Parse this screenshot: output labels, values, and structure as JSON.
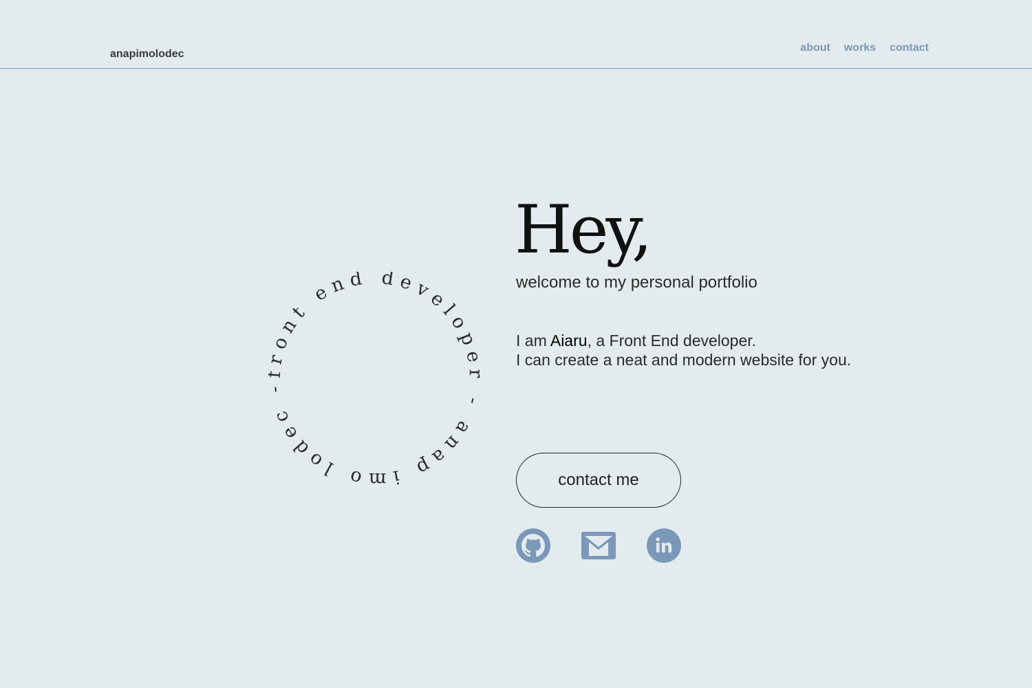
{
  "header": {
    "logo": "anapimolodec",
    "nav": [
      {
        "label": "about"
      },
      {
        "label": "works"
      },
      {
        "label": "contact"
      }
    ]
  },
  "badge": {
    "circular_text": "front end developer - anap imo lodec -"
  },
  "hero": {
    "heading": "Hey,",
    "subtitle": "welcome to my personal portfolio",
    "intro_prefix": "I am ",
    "intro_name": "Aiaru",
    "intro_suffix": ", a Front End developer.",
    "intro_line2": "I can create a neat and modern website for you.",
    "cta_label": "contact me"
  },
  "social": {
    "icons": [
      "github-icon",
      "gmail-icon",
      "linkedin-icon"
    ]
  },
  "colors": {
    "background": "#e3ebee",
    "accent": "#7b98b8",
    "text": "#222222"
  }
}
